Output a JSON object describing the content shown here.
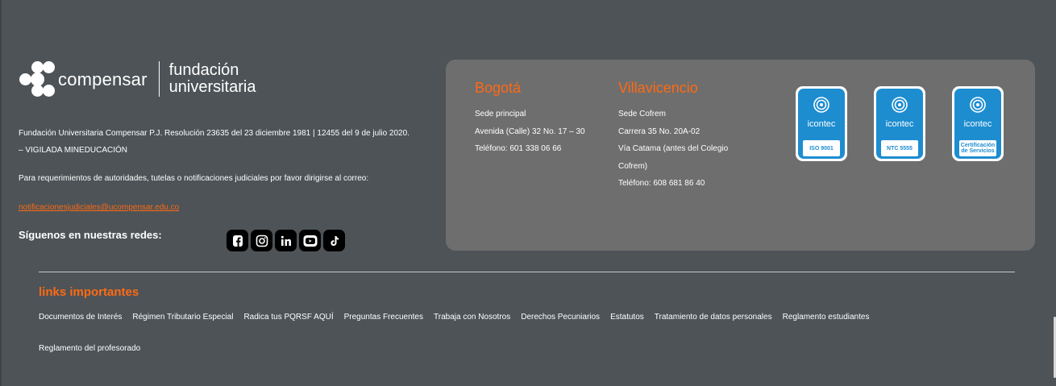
{
  "logo": {
    "brand": "compensar",
    "subtitle_line1": "fundación",
    "subtitle_line2": "universitaria"
  },
  "legal_text": "Fundación Universitaria Compensar P.J. Resolución 23635 del 23 diciembre 1981 | 12455 del 9 de julio 2020. – VIGILADA MINEDUCACIÓN",
  "requirements_text": "Para requerimientos de autoridades, tutelas o notificaciones judiciales por favor dirigirse al correo:",
  "email": "notificacionesjudiciales@ucompensar.edu.co",
  "follow_label": "Síguenos en nuestras redes:",
  "socials": [
    {
      "name": "facebook-icon",
      "glyph": "f"
    },
    {
      "name": "instagram-icon",
      "glyph": "ig"
    },
    {
      "name": "linkedin-icon",
      "glyph": "in"
    },
    {
      "name": "youtube-icon",
      "glyph": "yt"
    },
    {
      "name": "tiktok-icon",
      "glyph": "tt"
    }
  ],
  "sedes": [
    {
      "city": "Bogotá",
      "lines": [
        "Sede principal",
        "Avenida (Calle) 32 No. 17 – 30",
        "Teléfono: 601 338 06 66"
      ]
    },
    {
      "city": "Villavicencio",
      "lines": [
        "Sede Cofrem",
        "Carrera 35 No. 20A-02",
        "Vía Catama (antes del Colegio",
        "Cofrem)",
        "Teléfono: 608 681 86 40"
      ]
    }
  ],
  "certifications": [
    {
      "brand": "icontec",
      "label_line1": "ISO 9001",
      "label_line2": ""
    },
    {
      "brand": "icontec",
      "label_line1": "NTC 5555",
      "label_line2": ""
    },
    {
      "brand": "icontec",
      "label_line1": "Certificación",
      "label_line2": "de Servicios"
    }
  ],
  "links_title": "links importantes",
  "links": [
    "Documentos de Interés",
    "Régimen Tributario Especial",
    "Radica tus PQRSF AQUÍ",
    "Preguntas Frecuentes",
    "Trabaja con Nosotros",
    "Derechos Pecuniarios",
    "Estatutos",
    "Tratamiento de datos personales",
    "Reglamento estudiantes"
  ],
  "links_row2": [
    "Reglamento del profesorado"
  ],
  "colors": {
    "background": "#4d5357",
    "card": "#6e6e6e",
    "accent": "#ff6a13",
    "cert_blue": "#1d8dd0"
  }
}
